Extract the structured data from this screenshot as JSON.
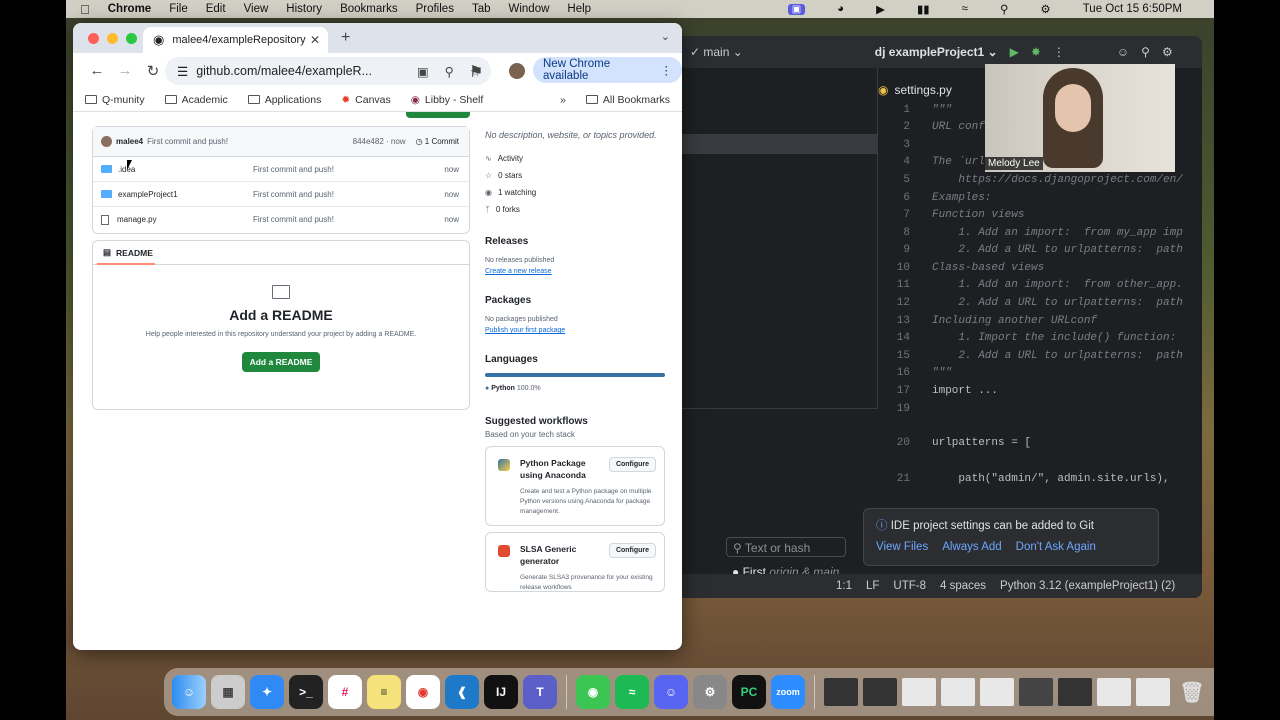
{
  "menubar": {
    "app": "Chrome",
    "items": [
      "File",
      "Edit",
      "View",
      "History",
      "Bookmarks",
      "Profiles",
      "Tab",
      "Window",
      "Help"
    ],
    "clock": "Tue Oct 15  6:50PM"
  },
  "browser": {
    "tab_title": "malee4/exampleRepository",
    "url": "github.com/malee4/exampleR...",
    "update_button": "New Chrome available",
    "bookmarks": [
      "Q-munity",
      "Academic",
      "Applications",
      "Canvas",
      "Libby - Shelf"
    ],
    "all_bookmarks": "All Bookmarks"
  },
  "repo": {
    "commit": {
      "author": "malee4",
      "message": "First commit and push!",
      "hash_time": "844e482 · now",
      "count": "1 Commit"
    },
    "files": [
      {
        "name": ".idea",
        "type": "folder",
        "message": "First commit and push!",
        "age": "now"
      },
      {
        "name": "exampleProject1",
        "type": "folder",
        "message": "First commit and push!",
        "age": "now"
      },
      {
        "name": "manage.py",
        "type": "file",
        "message": "First commit and push!",
        "age": "now"
      }
    ],
    "readme": {
      "tab": "README",
      "title": "Add a README",
      "desc": "Help people interested in this repository understand your project by adding a README.",
      "button": "Add a README"
    },
    "about": {
      "desc": "No description, website, or topics provided.",
      "stats": [
        "Activity",
        "0 stars",
        "1 watching",
        "0 forks"
      ]
    },
    "releases": {
      "title": "Releases",
      "none": "No releases published",
      "link": "Create a new release"
    },
    "packages": {
      "title": "Packages",
      "none": "No packages published",
      "link": "Publish your first package"
    },
    "languages": {
      "title": "Languages",
      "lang": "Python",
      "pct": "100.0%"
    },
    "workflows": {
      "title": "Suggested workflows",
      "sub": "Based on your tech stack",
      "cards": [
        {
          "title": "Python Package using Anaconda",
          "desc": "Create and test a Python package on multiple Python versions using Anaconda for package management.",
          "button": "Configure"
        },
        {
          "title": "SLSA Generic generator",
          "desc": "Generate SLSA3 provenance for your existing release workflows",
          "button": "Configure"
        }
      ]
    }
  },
  "ide": {
    "branch": "main",
    "project": "exampleProject1",
    "file_tab": "settings.py",
    "code_lines": [
      {
        "n": "1",
        "t": "\"\"\""
      },
      {
        "n": "2",
        "t": "URL confi"
      },
      {
        "n": "3",
        "t": ""
      },
      {
        "n": "4",
        "t": "The `url"
      },
      {
        "n": "5",
        "t": "    https://docs.djangoproject.com/en/"
      },
      {
        "n": "6",
        "t": "Examples:"
      },
      {
        "n": "7",
        "t": "Function views"
      },
      {
        "n": "8",
        "t": "    1. Add an import:  from my_app imp"
      },
      {
        "n": "9",
        "t": "    2. Add a URL to urlpatterns:  path"
      },
      {
        "n": "10",
        "t": "Class-based views"
      },
      {
        "n": "11",
        "t": "    1. Add an import:  from other_app."
      },
      {
        "n": "12",
        "t": "    2. Add a URL to urlpatterns:  path"
      },
      {
        "n": "13",
        "t": "Including another URLconf"
      },
      {
        "n": "14",
        "t": "    1. Import the include() function:"
      },
      {
        "n": "15",
        "t": "    2. Add a URL to urlpatterns:  path"
      },
      {
        "n": "16",
        "t": "\"\"\""
      },
      {
        "n": "17",
        "t": "import ..."
      },
      {
        "n": "19",
        "t": ""
      },
      {
        "n": "20",
        "t": "urlpatterns = ["
      },
      {
        "n": "21",
        "t": "    path(\"admin/\", admin.site.urls),"
      }
    ],
    "search_placeholder": "Text or hash",
    "commit_row": "First",
    "commit_branch": "origin & main",
    "status": [
      "1:1",
      "LF",
      "UTF-8",
      "4 spaces",
      "Python 3.12 (exampleProject1) (2)"
    ],
    "notification": {
      "text": "IDE project settings can be added to Git",
      "links": [
        "View Files",
        "Always Add",
        "Don't Ask Again"
      ]
    }
  },
  "webcam": {
    "name": "Melody Lee"
  }
}
